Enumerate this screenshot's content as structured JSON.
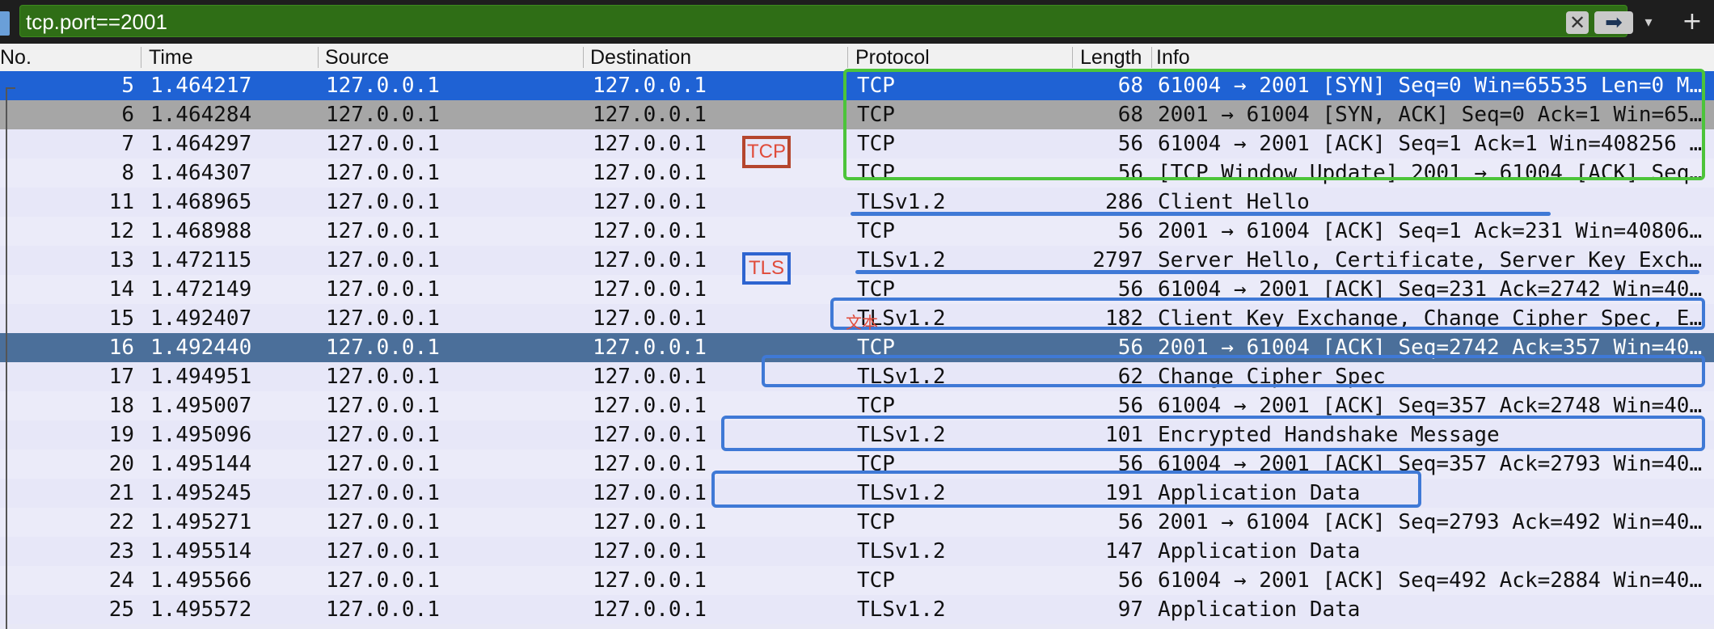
{
  "filter": {
    "value": "tcp.port==2001",
    "clear_icon": "✕",
    "apply_icon": "➡",
    "dropdown_icon": "▾",
    "add_icon": "+"
  },
  "columns": {
    "no": "No.",
    "time": "Time",
    "source": "Source",
    "destination": "Destination",
    "protocol": "Protocol",
    "length": "Length",
    "info": "Info"
  },
  "packets": [
    {
      "no": "5",
      "time": "1.464217",
      "source": "127.0.0.1",
      "destination": "127.0.0.1",
      "protocol": "TCP",
      "length": "68",
      "info": "61004 → 2001 [SYN] Seq=0 Win=65535 Len=0 M…",
      "state": "selected"
    },
    {
      "no": "6",
      "time": "1.464284",
      "source": "127.0.0.1",
      "destination": "127.0.0.1",
      "protocol": "TCP",
      "length": "68",
      "info": "2001 → 61004 [SYN, ACK] Seq=0 Ack=1 Win=65…",
      "state": "related"
    },
    {
      "no": "7",
      "time": "1.464297",
      "source": "127.0.0.1",
      "destination": "127.0.0.1",
      "protocol": "TCP",
      "length": "56",
      "info": "61004 → 2001 [ACK] Seq=1 Ack=1 Win=408256 …",
      "state": "normal"
    },
    {
      "no": "8",
      "time": "1.464307",
      "source": "127.0.0.1",
      "destination": "127.0.0.1",
      "protocol": "TCP",
      "length": "56",
      "info": "[TCP Window Update] 2001 → 61004 [ACK] Seq…",
      "state": "normal"
    },
    {
      "no": "11",
      "time": "1.468965",
      "source": "127.0.0.1",
      "destination": "127.0.0.1",
      "protocol": "TLSv1.2",
      "length": "286",
      "info": "Client Hello",
      "state": "normal"
    },
    {
      "no": "12",
      "time": "1.468988",
      "source": "127.0.0.1",
      "destination": "127.0.0.1",
      "protocol": "TCP",
      "length": "56",
      "info": "2001 → 61004 [ACK] Seq=1 Ack=231 Win=40806…",
      "state": "normal"
    },
    {
      "no": "13",
      "time": "1.472115",
      "source": "127.0.0.1",
      "destination": "127.0.0.1",
      "protocol": "TLSv1.2",
      "length": "2797",
      "info": "Server Hello, Certificate, Server Key Exch…",
      "state": "normal"
    },
    {
      "no": "14",
      "time": "1.472149",
      "source": "127.0.0.1",
      "destination": "127.0.0.1",
      "protocol": "TCP",
      "length": "56",
      "info": "61004 → 2001 [ACK] Seq=231 Ack=2742 Win=40…",
      "state": "normal"
    },
    {
      "no": "15",
      "time": "1.492407",
      "source": "127.0.0.1",
      "destination": "127.0.0.1",
      "protocol": "TLSv1.2",
      "length": "182",
      "info": "Client Key Exchange, Change Cipher Spec, E…",
      "state": "normal"
    },
    {
      "no": "16",
      "time": "1.492440",
      "source": "127.0.0.1",
      "destination": "127.0.0.1",
      "protocol": "TCP",
      "length": "56",
      "info": "2001 → 61004 [ACK] Seq=2742 Ack=357 Win=40…",
      "state": "inactive"
    },
    {
      "no": "17",
      "time": "1.494951",
      "source": "127.0.0.1",
      "destination": "127.0.0.1",
      "protocol": "TLSv1.2",
      "length": "62",
      "info": "Change Cipher Spec",
      "state": "normal"
    },
    {
      "no": "18",
      "time": "1.495007",
      "source": "127.0.0.1",
      "destination": "127.0.0.1",
      "protocol": "TCP",
      "length": "56",
      "info": "61004 → 2001 [ACK] Seq=357 Ack=2748 Win=40…",
      "state": "normal"
    },
    {
      "no": "19",
      "time": "1.495096",
      "source": "127.0.0.1",
      "destination": "127.0.0.1",
      "protocol": "TLSv1.2",
      "length": "101",
      "info": "Encrypted Handshake Message",
      "state": "normal"
    },
    {
      "no": "20",
      "time": "1.495144",
      "source": "127.0.0.1",
      "destination": "127.0.0.1",
      "protocol": "TCP",
      "length": "56",
      "info": "61004 → 2001 [ACK] Seq=357 Ack=2793 Win=40…",
      "state": "normal"
    },
    {
      "no": "21",
      "time": "1.495245",
      "source": "127.0.0.1",
      "destination": "127.0.0.1",
      "protocol": "TLSv1.2",
      "length": "191",
      "info": "Application Data",
      "state": "normal"
    },
    {
      "no": "22",
      "time": "1.495271",
      "source": "127.0.0.1",
      "destination": "127.0.0.1",
      "protocol": "TCP",
      "length": "56",
      "info": "2001 → 61004 [ACK] Seq=2793 Ack=492 Win=40…",
      "state": "normal"
    },
    {
      "no": "23",
      "time": "1.495514",
      "source": "127.0.0.1",
      "destination": "127.0.0.1",
      "protocol": "TLSv1.2",
      "length": "147",
      "info": "Application Data",
      "state": "normal"
    },
    {
      "no": "24",
      "time": "1.495566",
      "source": "127.0.0.1",
      "destination": "127.0.0.1",
      "protocol": "TCP",
      "length": "56",
      "info": "61004 → 2001 [ACK] Seq=492 Ack=2884 Win=40…",
      "state": "normal"
    },
    {
      "no": "25",
      "time": "1.495572",
      "source": "127.0.0.1",
      "destination": "127.0.0.1",
      "protocol": "TLSv1.2",
      "length": "97",
      "info": "Application Data",
      "state": "normal"
    }
  ],
  "annotations": {
    "tcp_label": "TCP",
    "tls_label": "TLS",
    "text_label": "文本"
  },
  "colors": {
    "selected_row": "#1f62d4",
    "related_row": "#a6a6a6",
    "inactive_selected_row": "#4b6f9a",
    "filter_valid": "#2f6e16",
    "annotation_green": "#4cc43a",
    "annotation_blue": "#3f79d6"
  }
}
